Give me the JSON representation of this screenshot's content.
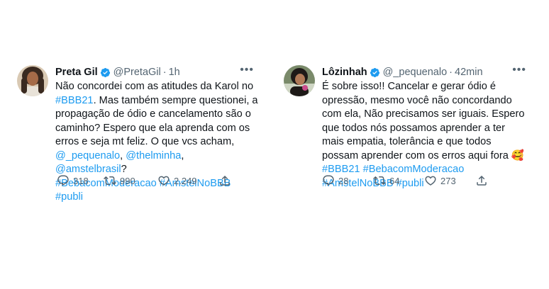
{
  "tweets": [
    {
      "name": "Preta Gil",
      "handle": "@PretaGil",
      "time": "1h",
      "text_lines": [
        [
          {
            "t": "Não concordei com as atitudes da Karol no"
          }
        ],
        [
          {
            "t": "#BBB21",
            "link": true
          },
          {
            "t": ". Mas também sempre questionei, a"
          }
        ],
        [
          {
            "t": "propagação de ódio e cancelamento são o"
          }
        ],
        [
          {
            "t": "caminho? Espero que ela aprenda com os"
          }
        ],
        [
          {
            "t": "erros e seja mt feliz. O que vcs acham,"
          }
        ],
        [
          {
            "t": "@_pequenalo",
            "link": true
          },
          {
            "t": ", "
          },
          {
            "t": "@thelminha",
            "link": true
          },
          {
            "t": ", "
          },
          {
            "t": "@amstelbrasil",
            "link": true
          },
          {
            "t": "?"
          }
        ],
        [
          {
            "t": "#BebacomModeracao #AmstelNoBBB",
            "link": true
          }
        ],
        [
          {
            "t": "#publi",
            "link": true
          }
        ]
      ],
      "replies": "318",
      "retweets": "990",
      "likes": "2.249"
    },
    {
      "name": "Lôzinhah",
      "handle": "@_pequenalo",
      "time": "42min",
      "text_lines": [
        [
          {
            "t": "É sobre isso!! Cancelar e gerar ódio é"
          }
        ],
        [
          {
            "t": "opressão, mesmo você não concordando"
          }
        ],
        [
          {
            "t": "com ela, Não precisamos ser iguais. Espero"
          }
        ],
        [
          {
            "t": "que todos nós possamos aprender a ter"
          }
        ],
        [
          {
            "t": "mais empatia, tolerância e que todos"
          }
        ],
        [
          {
            "t": "possam aprender com os erros aqui fora "
          },
          {
            "t": "🥰",
            "emoji": true
          }
        ],
        [
          {
            "t": "#BBB21 #BebacomModeracao",
            "link": true
          }
        ],
        [
          {
            "t": "#AmstelNoBBB #publi",
            "link": true
          }
        ]
      ],
      "replies": "28",
      "retweets": "64",
      "likes": "273"
    }
  ],
  "colors": {
    "link": "#1d9bf0",
    "secondary": "#536471",
    "text": "#0f1419",
    "verified": "#1d9bf0"
  },
  "icons": [
    "verified-badge-icon",
    "more-icon",
    "reply-icon",
    "retweet-icon",
    "like-icon",
    "share-icon"
  ]
}
